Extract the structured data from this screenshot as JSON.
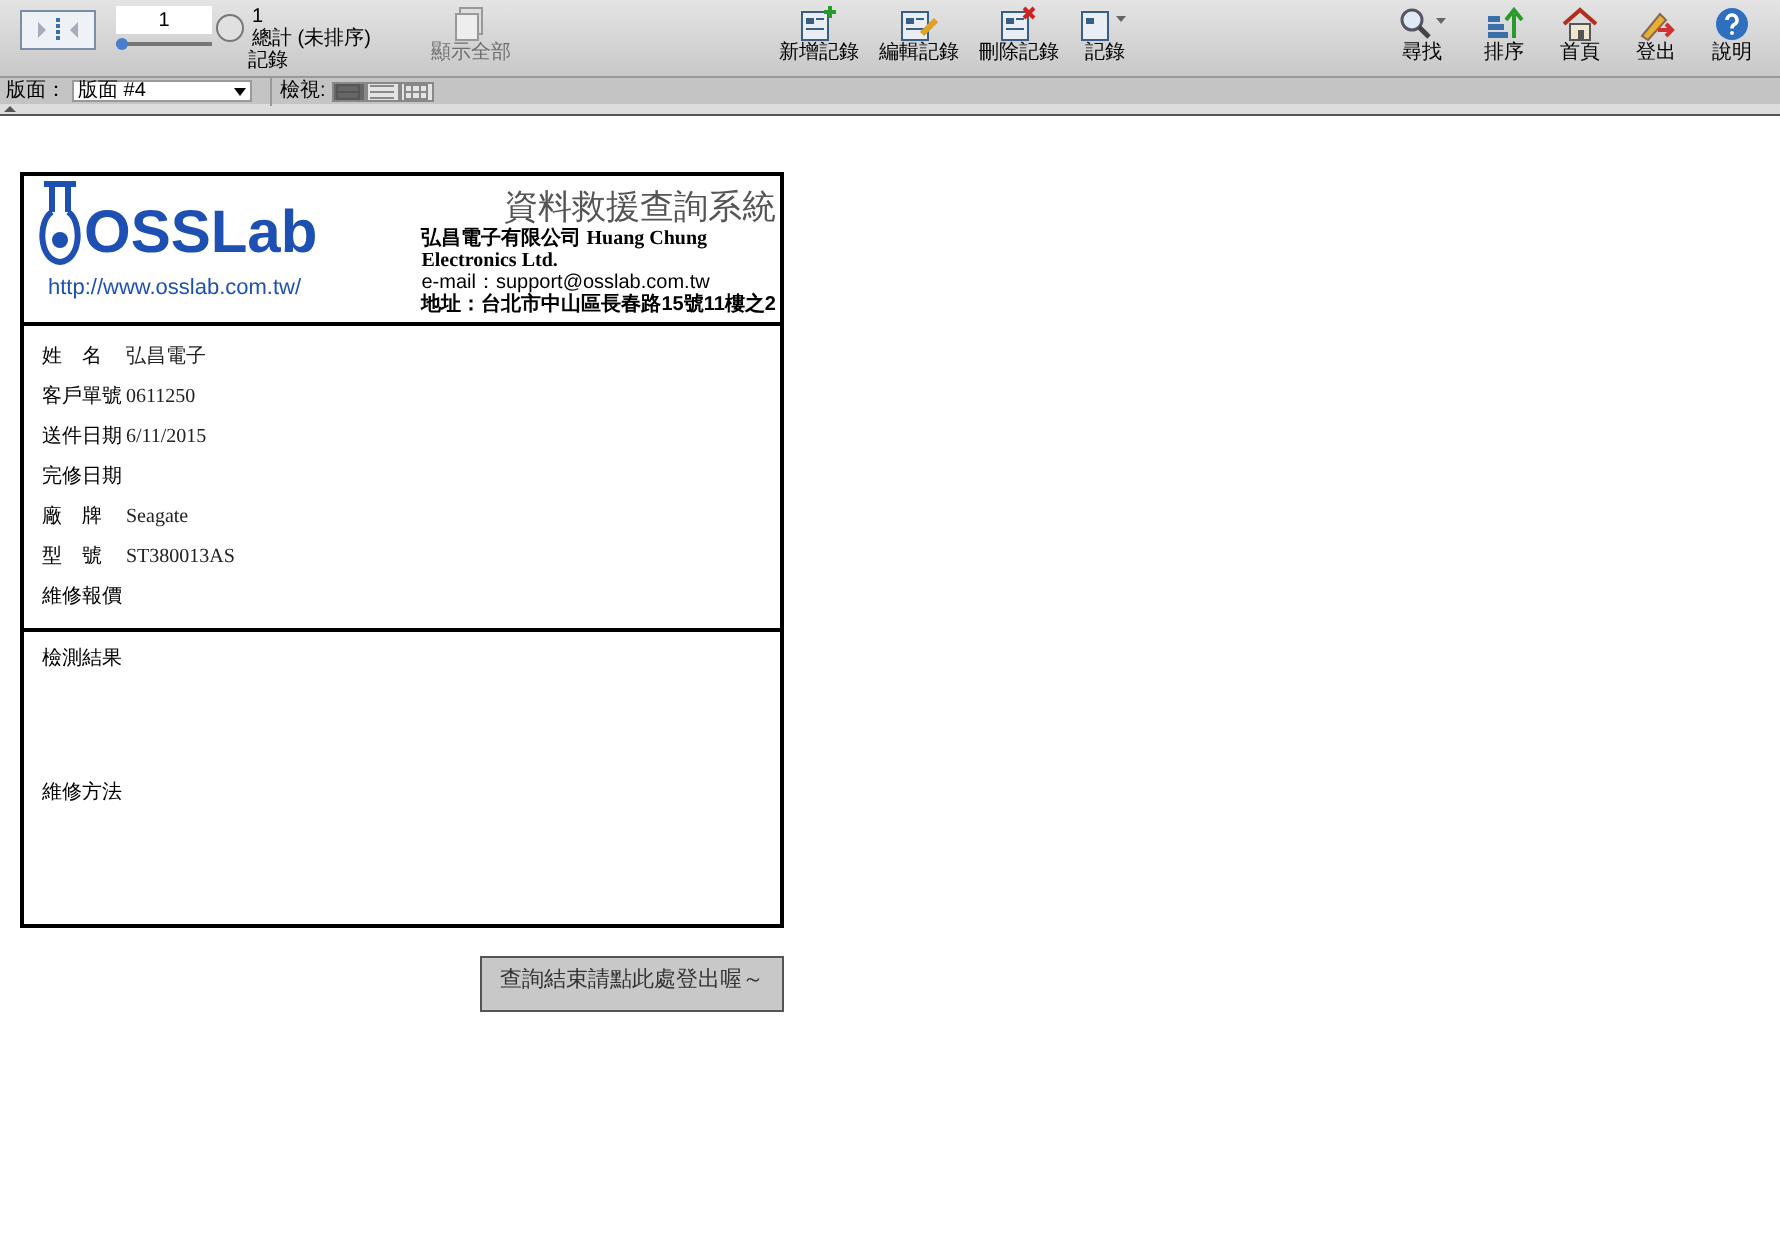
{
  "toolbar": {
    "record_number": "1",
    "record_slider": {
      "level": 0.0
    },
    "total": "1",
    "total_label": "總計 (未排序)",
    "records_label": "記錄",
    "show_all": {
      "label": "顯示全部",
      "disabled": true
    },
    "actions": [
      {
        "kind": "new",
        "label": "新增記錄"
      },
      {
        "kind": "edit",
        "label": "編輯記錄"
      },
      {
        "kind": "delete",
        "label": "刪除記錄"
      },
      {
        "kind": "records",
        "label": "記錄"
      }
    ],
    "right_actions": [
      {
        "kind": "find",
        "label": "尋找"
      },
      {
        "kind": "sort",
        "label": "排序"
      },
      {
        "kind": "home",
        "label": "首頁"
      },
      {
        "kind": "logout",
        "label": "登出"
      },
      {
        "kind": "help",
        "label": "說明"
      }
    ]
  },
  "layout_bar": {
    "layout_label": "版面：",
    "layout_value": "版面 #4",
    "view_label": "檢視:",
    "views": [
      {
        "kind": "form",
        "selected": true
      },
      {
        "kind": "list",
        "selected": false
      },
      {
        "kind": "table",
        "selected": false
      }
    ]
  },
  "card": {
    "logo_text": "OSSLab",
    "logo_url": "http://www.osslab.com.tw/",
    "system_title": "資料救援查詢系統",
    "company": "弘昌電子有限公司 Huang Chung Electronics Ltd.",
    "email": "e-mail：support@osslab.com.tw",
    "address": "地址：台北市中山區長春路15號11樓之2",
    "fields": [
      {
        "label": "姓　名",
        "value": "弘昌電子"
      },
      {
        "label": "客戶單號",
        "value": "0611250"
      },
      {
        "label": "送件日期",
        "value": "6/11/2015"
      },
      {
        "label": "完修日期"
      },
      {
        "label": "廠　牌",
        "value": "Seagate"
      },
      {
        "label": "型　號",
        "value": "ST380013AS"
      },
      {
        "label": "維修報價"
      }
    ],
    "results": [
      {
        "label": "檢測結果"
      },
      {
        "label": "維修方法"
      }
    ]
  },
  "logout_button": "查詢結束請點此處登出喔～"
}
